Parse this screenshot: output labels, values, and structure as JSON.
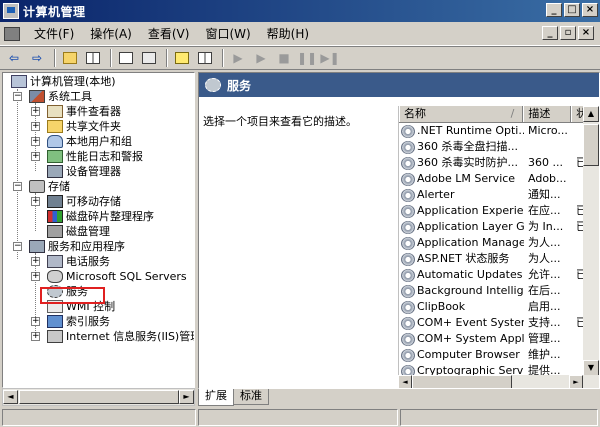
{
  "window": {
    "title": "计算机管理",
    "minimize": "_",
    "maximize": "□",
    "close": "×"
  },
  "menu": {
    "items": [
      "文件(F)",
      "操作(A)",
      "查看(V)",
      "窗口(W)",
      "帮助(H)"
    ],
    "mdi": {
      "minimize": "_",
      "restore": "▫",
      "close": "×"
    }
  },
  "toolbar": {
    "back": "⇦",
    "forward": "⇨",
    "play": "▶",
    "step": "▶",
    "stop": "■",
    "pause": "❚❚",
    "restart": "▶❚"
  },
  "tree": {
    "root": "计算机管理(本地)",
    "system_tools": "系统工具",
    "event_viewer": "事件查看器",
    "shared_folders": "共享文件夹",
    "local_users": "本地用户和组",
    "perf_logs": "性能日志和警报",
    "device_manager": "设备管理器",
    "storage": "存储",
    "removable_storage": "可移动存储",
    "defrag": "磁盘碎片整理程序",
    "disk_mgmt": "磁盘管理",
    "services_apps": "服务和应用程序",
    "telephony": "电话服务",
    "sql_servers": "Microsoft SQL Servers",
    "services": "服务",
    "wmi": "WMI 控制",
    "indexing": "索引服务",
    "iis": "Internet 信息服务(IIS)管理",
    "expand": "+",
    "collapse": "−"
  },
  "right": {
    "header_title": "服务",
    "description_prompt": "选择一个项目来查看它的描述。",
    "columns": {
      "name": "名称",
      "sort_indicator": "/",
      "desc": "描述",
      "status": "状"
    },
    "rows": [
      {
        "name": ".NET Runtime Opti...",
        "desc": "Micro...",
        "status": ""
      },
      {
        "name": "360 杀毒全盘扫描...",
        "desc": "",
        "status": ""
      },
      {
        "name": "360 杀毒实时防护...",
        "desc": "360 ...",
        "status": "已"
      },
      {
        "name": "Adobe LM Service",
        "desc": "Adob...",
        "status": ""
      },
      {
        "name": "Alerter",
        "desc": "通知...",
        "status": ""
      },
      {
        "name": "Application Experie...",
        "desc": "在应...",
        "status": "已"
      },
      {
        "name": "Application Layer G...",
        "desc": "为 In...",
        "status": "已"
      },
      {
        "name": "Application Manage...",
        "desc": "为人...",
        "status": ""
      },
      {
        "name": "ASP.NET 状态服务",
        "desc": "为人...",
        "status": ""
      },
      {
        "name": "Automatic Updates",
        "desc": "允许...",
        "status": "已"
      },
      {
        "name": "Background Intellig...",
        "desc": "在后...",
        "status": ""
      },
      {
        "name": "ClipBook",
        "desc": "启用...",
        "status": ""
      },
      {
        "name": "COM+ Event System",
        "desc": "支持...",
        "status": "已"
      },
      {
        "name": "COM+ System Appl...",
        "desc": "管理...",
        "status": ""
      },
      {
        "name": "Computer Browser",
        "desc": "维护...",
        "status": ""
      },
      {
        "name": "Cryptographic Servi...",
        "desc": "提供...",
        "status": ""
      }
    ]
  },
  "tabs": {
    "extended": "扩展",
    "standard": "标准"
  },
  "scroll_arrows": {
    "left": "◄",
    "right": "►",
    "up": "▲",
    "down": "▼"
  }
}
